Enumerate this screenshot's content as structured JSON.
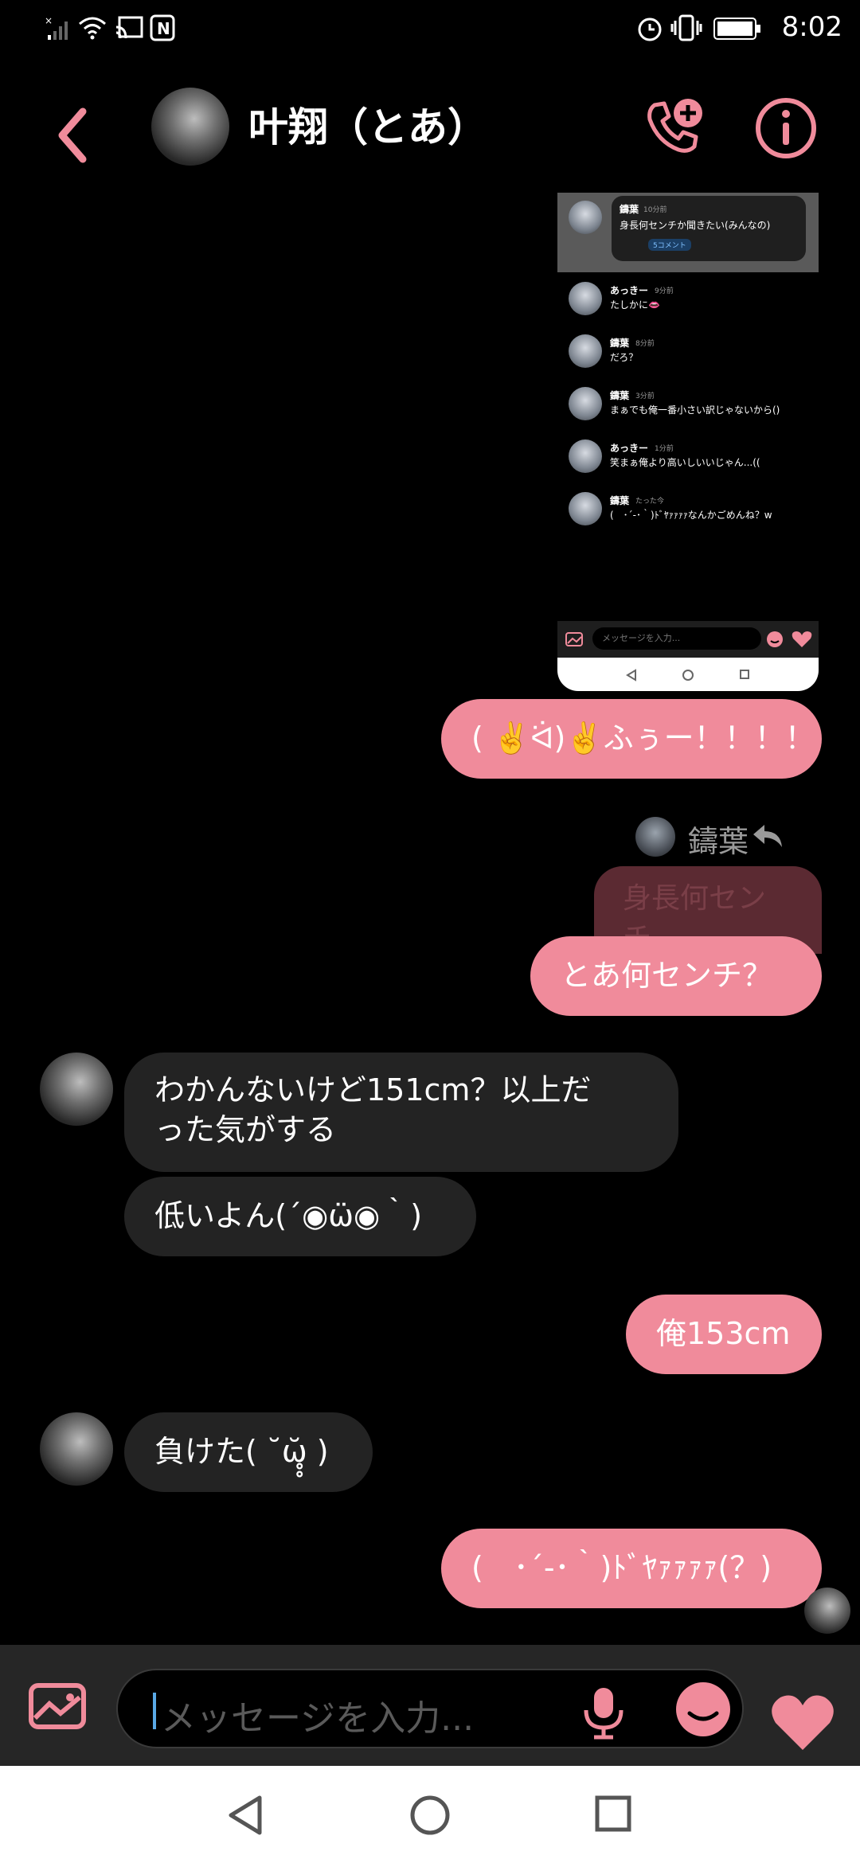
{
  "status_bar": {
    "time": "8:02"
  },
  "header": {
    "title": "叶翔（とあ）"
  },
  "screenshot": {
    "post": {
      "name": "鑄葉",
      "time": "10分前",
      "text": "身長何センチか聞きたい(みんなの)",
      "badge": "5コメント"
    },
    "comments": [
      {
        "name": "あっきー",
        "time": "9分前",
        "text": "たしかに👄"
      },
      {
        "name": "鑄葉",
        "time": "8分前",
        "text": "だろ？"
      },
      {
        "name": "鑄葉",
        "time": "3分前",
        "text": "まぁでも俺一番小さい訳じゃないから()"
      },
      {
        "name": "あっきー",
        "time": "1分前",
        "text": "笑まぁ俺より高いしいいじゃん...(("
      },
      {
        "name": "鑄葉",
        "time": "たった今",
        "text": "(　･´-･｀)ﾄﾞﾔｧｧｧｧなんかごめんね？w"
      }
    ],
    "input_placeholder": "メッセージを入力..."
  },
  "messages": {
    "m1": "( ✌️ᐛ)✌️ふぅー！！！！",
    "reply_name": "鑄葉",
    "reply_quote": "身長何センチ",
    "m2": "とあ何センチ？",
    "m3_line1": "わかんないけど151cm？以上だ",
    "m3_line2": "った気がする",
    "m4": "低いよん(´◉ω̈◉｀)",
    "m5": "俺153cm",
    "m6": "負けた( ˘ω̥̥̆ )",
    "m7": "(　･´-･｀)ﾄﾞﾔｧｧｧｧ(？)"
  },
  "input": {
    "placeholder": "メッセージを入力..."
  },
  "colors": {
    "accent": "#f08b9b",
    "background": "#000000",
    "incoming": "#232323"
  }
}
